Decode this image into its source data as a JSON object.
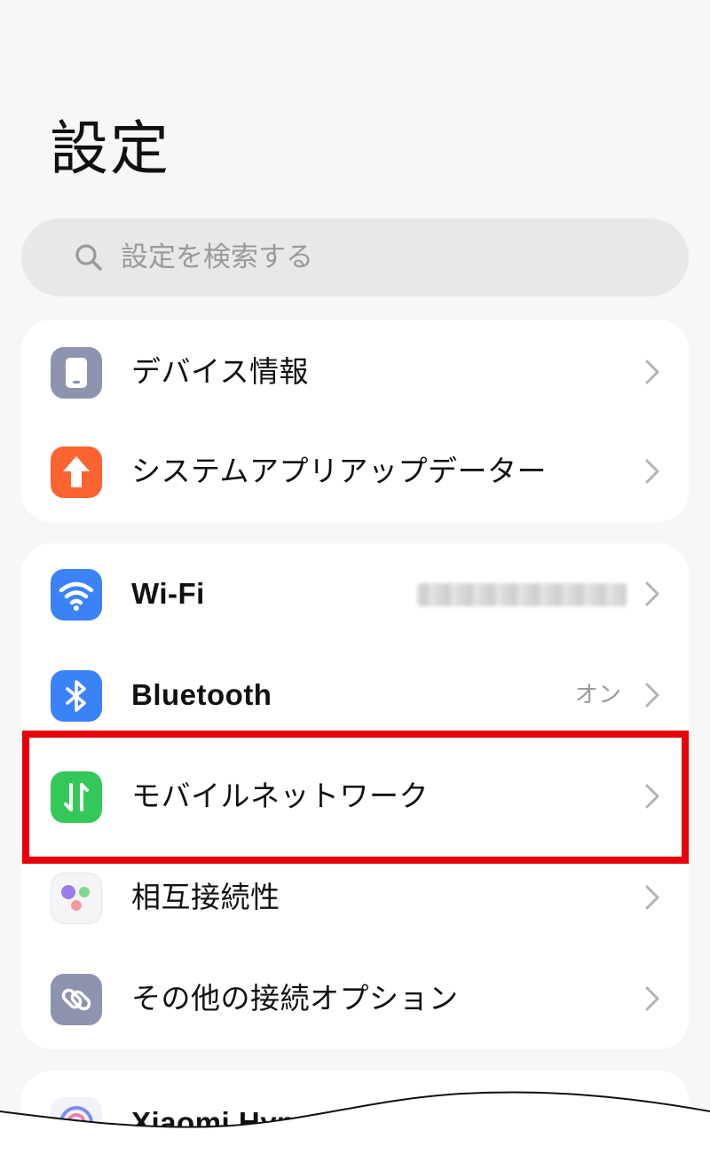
{
  "page": {
    "title": "設定"
  },
  "search": {
    "placeholder": "設定を検索する",
    "icon": "search-icon"
  },
  "groups": [
    {
      "items": [
        {
          "label": "デバイス情報",
          "icon": "phone-icon",
          "icon_color": "#8e93b0"
        },
        {
          "label": "システムアプリアップデーター",
          "icon": "arrow-up-icon",
          "icon_color": "#fb6331"
        }
      ]
    },
    {
      "items": [
        {
          "label": "Wi-Fi",
          "icon": "wifi-icon",
          "icon_color": "#3b82f6"
        },
        {
          "label": "Bluetooth",
          "value": "オン",
          "icon": "bluetooth-icon",
          "icon_color": "#3b82f6"
        },
        {
          "label": "モバイルネットワーク",
          "icon": "mobile-data-icon",
          "icon_color": "#34c759"
        },
        {
          "label": "相互接続性",
          "icon": "interconnect-icon",
          "icon_color": "#f4f4f6"
        },
        {
          "label": "その他の接続オプション",
          "icon": "link-icon",
          "icon_color": "#8e93b0"
        }
      ]
    },
    {
      "items": [
        {
          "label": "Xiaomi HyperAI",
          "icon": "hyperai-icon"
        }
      ]
    }
  ],
  "highlight": {
    "color": "#e8000a"
  },
  "colors": {
    "background": "#f7f7f7",
    "card": "#ffffff",
    "search_bg": "#e8e8e8",
    "chevron": "#b3b3b3"
  }
}
